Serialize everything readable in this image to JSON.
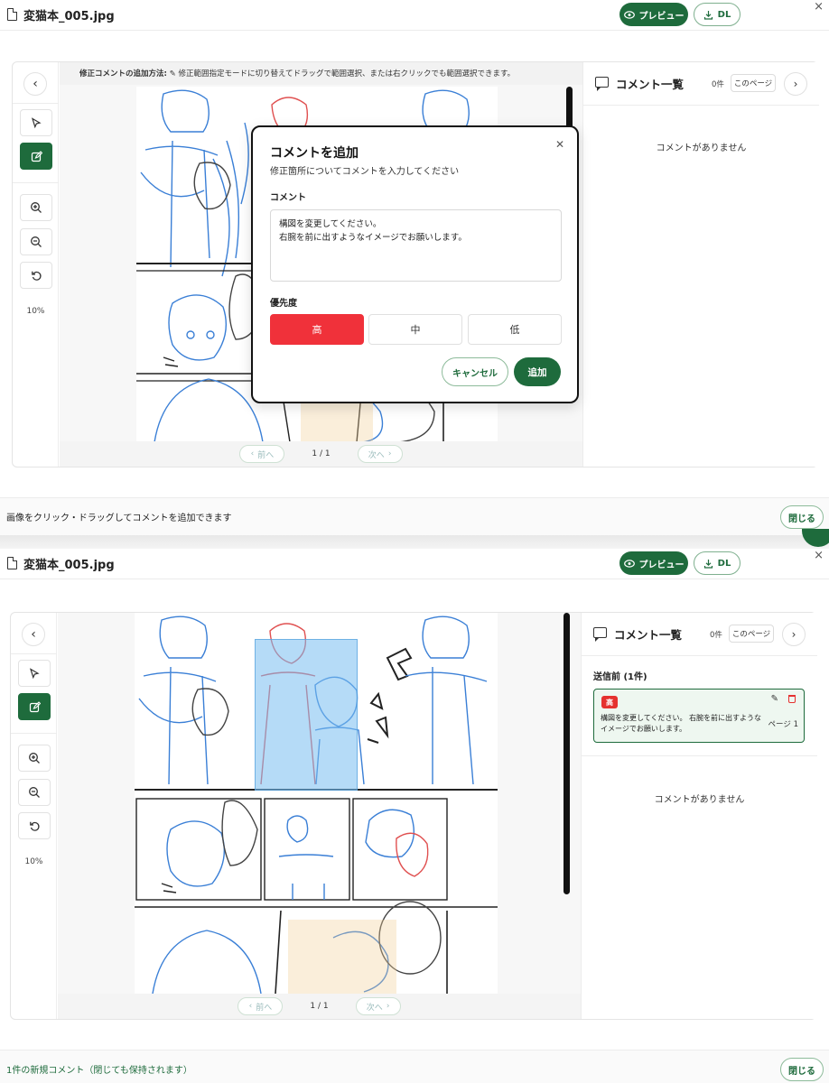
{
  "file": {
    "name": "変猫本_005.jpg"
  },
  "header": {
    "preview_label": "プレビュー",
    "download_label": "DL",
    "close_glyph": "×"
  },
  "toolbar": {
    "prev_glyph": "‹",
    "zoom_label": "10%"
  },
  "canvas": {
    "hint_bold": "修正コメントの追加方法:",
    "hint_text": "修正範囲指定モードに切り替えてドラッグで範囲選択、または右クリックでも範囲選択できます。"
  },
  "pager": {
    "prev_label": "前へ",
    "next_label": "次へ",
    "page_indicator": "1 / 1"
  },
  "side_top": {
    "title": "コメント一覧",
    "count": "0件",
    "page_filter": "このページ",
    "empty": "コメントがありません"
  },
  "side_bottom": {
    "title": "コメント一覧",
    "count": "0件",
    "page_filter": "このページ",
    "pending_title": "送信前 (1件)",
    "pending_card": {
      "priority": "高",
      "text": "構図を変更してください。 右腕を前に出すようなイメージでお願いします。",
      "page": "ページ 1"
    },
    "empty": "コメントがありません"
  },
  "modal": {
    "title": "コメントを追加",
    "subtitle": "修正箇所についてコメントを入力してください",
    "comment_label": "コメント",
    "comment_value": "構図を変更してください。\n右腕を前に出すようなイメージでお願いします。",
    "priority_label": "優先度",
    "priorities": {
      "high": "高",
      "mid": "中",
      "low": "低"
    },
    "selected_priority": "高",
    "cancel_label": "キャンセル",
    "add_label": "追加"
  },
  "footer_top": {
    "message": "画像をクリック・ドラッグしてコメントを追加できます",
    "close_label": "閉じる"
  },
  "footer_bottom": {
    "message": "1件の新規コメント（閉じても保持されます）",
    "close_label": "閉じる"
  },
  "colors": {
    "accent": "#1e6b3c",
    "high": "#f0313a",
    "sketch_blue": "#3a7fd6",
    "sketch_red": "#e05050"
  },
  "icons": {
    "file": "file-icon",
    "preview": "eye-icon",
    "download": "download-icon",
    "close": "close-icon",
    "pointer": "cursor-icon",
    "edit": "edit-icon",
    "zoom_in": "zoom-in-icon",
    "zoom_out": "zoom-out-icon",
    "reset": "rotate-ccw-icon",
    "comment": "comment-icon",
    "pencil": "pencil-icon",
    "trash": "trash-icon"
  }
}
